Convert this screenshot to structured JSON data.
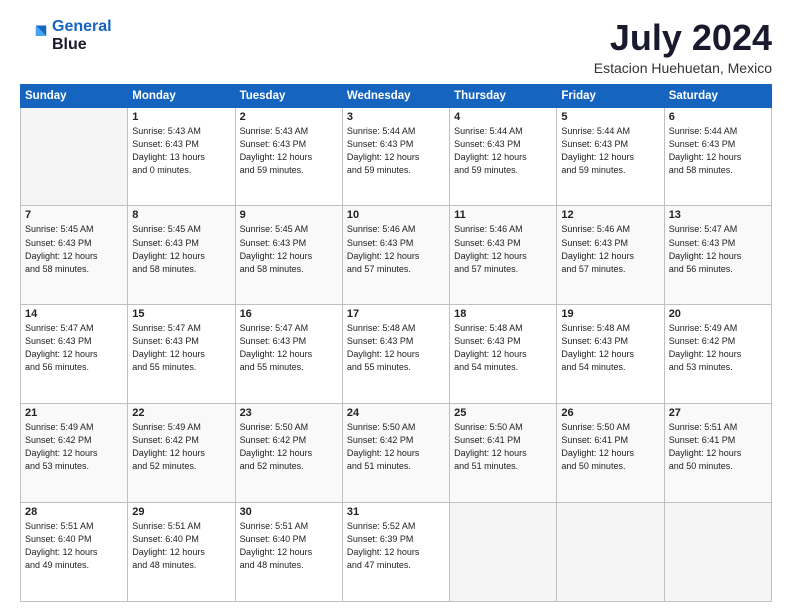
{
  "logo": {
    "line1": "General",
    "line2": "Blue"
  },
  "title": "July 2024",
  "location": "Estacion Huehuetan, Mexico",
  "days_header": [
    "Sunday",
    "Monday",
    "Tuesday",
    "Wednesday",
    "Thursday",
    "Friday",
    "Saturday"
  ],
  "weeks": [
    [
      {
        "day": "",
        "info": ""
      },
      {
        "day": "1",
        "info": "Sunrise: 5:43 AM\nSunset: 6:43 PM\nDaylight: 13 hours\nand 0 minutes."
      },
      {
        "day": "2",
        "info": "Sunrise: 5:43 AM\nSunset: 6:43 PM\nDaylight: 12 hours\nand 59 minutes."
      },
      {
        "day": "3",
        "info": "Sunrise: 5:44 AM\nSunset: 6:43 PM\nDaylight: 12 hours\nand 59 minutes."
      },
      {
        "day": "4",
        "info": "Sunrise: 5:44 AM\nSunset: 6:43 PM\nDaylight: 12 hours\nand 59 minutes."
      },
      {
        "day": "5",
        "info": "Sunrise: 5:44 AM\nSunset: 6:43 PM\nDaylight: 12 hours\nand 59 minutes."
      },
      {
        "day": "6",
        "info": "Sunrise: 5:44 AM\nSunset: 6:43 PM\nDaylight: 12 hours\nand 58 minutes."
      }
    ],
    [
      {
        "day": "7",
        "info": "Sunrise: 5:45 AM\nSunset: 6:43 PM\nDaylight: 12 hours\nand 58 minutes."
      },
      {
        "day": "8",
        "info": "Sunrise: 5:45 AM\nSunset: 6:43 PM\nDaylight: 12 hours\nand 58 minutes."
      },
      {
        "day": "9",
        "info": "Sunrise: 5:45 AM\nSunset: 6:43 PM\nDaylight: 12 hours\nand 58 minutes."
      },
      {
        "day": "10",
        "info": "Sunrise: 5:46 AM\nSunset: 6:43 PM\nDaylight: 12 hours\nand 57 minutes."
      },
      {
        "day": "11",
        "info": "Sunrise: 5:46 AM\nSunset: 6:43 PM\nDaylight: 12 hours\nand 57 minutes."
      },
      {
        "day": "12",
        "info": "Sunrise: 5:46 AM\nSunset: 6:43 PM\nDaylight: 12 hours\nand 57 minutes."
      },
      {
        "day": "13",
        "info": "Sunrise: 5:47 AM\nSunset: 6:43 PM\nDaylight: 12 hours\nand 56 minutes."
      }
    ],
    [
      {
        "day": "14",
        "info": "Sunrise: 5:47 AM\nSunset: 6:43 PM\nDaylight: 12 hours\nand 56 minutes."
      },
      {
        "day": "15",
        "info": "Sunrise: 5:47 AM\nSunset: 6:43 PM\nDaylight: 12 hours\nand 55 minutes."
      },
      {
        "day": "16",
        "info": "Sunrise: 5:47 AM\nSunset: 6:43 PM\nDaylight: 12 hours\nand 55 minutes."
      },
      {
        "day": "17",
        "info": "Sunrise: 5:48 AM\nSunset: 6:43 PM\nDaylight: 12 hours\nand 55 minutes."
      },
      {
        "day": "18",
        "info": "Sunrise: 5:48 AM\nSunset: 6:43 PM\nDaylight: 12 hours\nand 54 minutes."
      },
      {
        "day": "19",
        "info": "Sunrise: 5:48 AM\nSunset: 6:43 PM\nDaylight: 12 hours\nand 54 minutes."
      },
      {
        "day": "20",
        "info": "Sunrise: 5:49 AM\nSunset: 6:42 PM\nDaylight: 12 hours\nand 53 minutes."
      }
    ],
    [
      {
        "day": "21",
        "info": "Sunrise: 5:49 AM\nSunset: 6:42 PM\nDaylight: 12 hours\nand 53 minutes."
      },
      {
        "day": "22",
        "info": "Sunrise: 5:49 AM\nSunset: 6:42 PM\nDaylight: 12 hours\nand 52 minutes."
      },
      {
        "day": "23",
        "info": "Sunrise: 5:50 AM\nSunset: 6:42 PM\nDaylight: 12 hours\nand 52 minutes."
      },
      {
        "day": "24",
        "info": "Sunrise: 5:50 AM\nSunset: 6:42 PM\nDaylight: 12 hours\nand 51 minutes."
      },
      {
        "day": "25",
        "info": "Sunrise: 5:50 AM\nSunset: 6:41 PM\nDaylight: 12 hours\nand 51 minutes."
      },
      {
        "day": "26",
        "info": "Sunrise: 5:50 AM\nSunset: 6:41 PM\nDaylight: 12 hours\nand 50 minutes."
      },
      {
        "day": "27",
        "info": "Sunrise: 5:51 AM\nSunset: 6:41 PM\nDaylight: 12 hours\nand 50 minutes."
      }
    ],
    [
      {
        "day": "28",
        "info": "Sunrise: 5:51 AM\nSunset: 6:40 PM\nDaylight: 12 hours\nand 49 minutes."
      },
      {
        "day": "29",
        "info": "Sunrise: 5:51 AM\nSunset: 6:40 PM\nDaylight: 12 hours\nand 48 minutes."
      },
      {
        "day": "30",
        "info": "Sunrise: 5:51 AM\nSunset: 6:40 PM\nDaylight: 12 hours\nand 48 minutes."
      },
      {
        "day": "31",
        "info": "Sunrise: 5:52 AM\nSunset: 6:39 PM\nDaylight: 12 hours\nand 47 minutes."
      },
      {
        "day": "",
        "info": ""
      },
      {
        "day": "",
        "info": ""
      },
      {
        "day": "",
        "info": ""
      }
    ]
  ]
}
